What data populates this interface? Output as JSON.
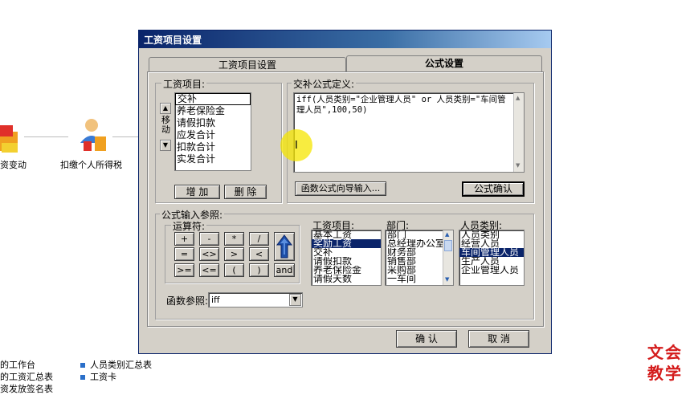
{
  "workflow": {
    "items": [
      {
        "label": "资变动"
      },
      {
        "label": "扣缴个人所得税"
      }
    ]
  },
  "bottom_links": {
    "col1": [
      "的工作台",
      "的工资汇总表",
      "资发放签名表"
    ],
    "col2": [
      "人员类别汇总表",
      "工资卡"
    ]
  },
  "brand": {
    "line1": "文会",
    "line2": "教学"
  },
  "dialog": {
    "title": "工资项目设置",
    "tabs": [
      {
        "label": "工资项目设置",
        "active": false
      },
      {
        "label": "公式设置",
        "active": true
      }
    ],
    "salary_items": {
      "label": "工资项目:",
      "move_label": "移动",
      "items": [
        "交补",
        "养老保险金",
        "请假扣款",
        "应发合计",
        "扣款合计",
        "实发合计"
      ],
      "selected_index": 0,
      "add_button": "增 加",
      "delete_button": "删 除"
    },
    "formula": {
      "label": "交补公式定义:",
      "text": "iff(人员类别=\"企业管理人员\" or 人员类别=\"车间管理人员\",100,50)",
      "wizard_button": "函数公式向导输入...",
      "confirm_button": "公式确认"
    },
    "reference": {
      "label": "公式输入参照:",
      "operators_label": "运算符:",
      "operators": [
        "+",
        "-",
        "*",
        "/",
        "=",
        "<>",
        ">",
        "<",
        ">=",
        "<=",
        "(",
        ")"
      ],
      "and_label": "and",
      "salary_items_label": "工资项目:",
      "salary_items": [
        "基本工资",
        "奖励工资",
        "交补",
        "请假扣款",
        "养老保险金",
        "请假天数"
      ],
      "salary_selected_index": 1,
      "departments_label": "部门:",
      "departments": [
        "部门",
        "总经理办公室",
        "财务部",
        "销售部",
        "采购部",
        "一车间"
      ],
      "categories_label": "人员类别:",
      "categories": [
        "人员类别",
        "经营人员",
        "车间管理人员",
        "生产人员",
        "企业管理人员"
      ],
      "category_selected_index": 2,
      "function_label": "函数参照:",
      "function_value": "iff"
    },
    "ok_button": "确 认",
    "cancel_button": "取 消"
  },
  "colors": {
    "title_start": "#0a246a",
    "title_end": "#a6caf0",
    "selection": "#0a246a",
    "dialog_face": "#d4d0c8",
    "brand_red": "#d41b1b",
    "cursor_highlight": "#f5e600"
  },
  "icons": [
    "arrow-up-icon",
    "arrow-down-icon",
    "big-up-arrow-icon",
    "combo-arrow-icon"
  ]
}
